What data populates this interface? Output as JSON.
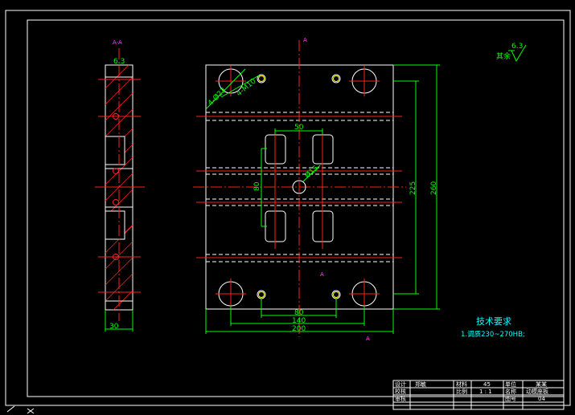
{
  "dimensions": {
    "d50": "50",
    "d80_vert": "80",
    "d80_bottom": "80",
    "d140": "140",
    "d200": "200",
    "d225": "225",
    "d260": "260",
    "d30": "30",
    "hole1": "4-Ø23",
    "hole2": "4-M10",
    "center_hole": "Ø15"
  },
  "roughness": {
    "value": "6.3",
    "prefix": "其余"
  },
  "technical": {
    "heading": "技术要求",
    "item1": "1.调质230~270HB;"
  },
  "title_block": {
    "design_label": "设计",
    "design_value": "郑敏",
    "check_label": "校核",
    "approve_label": "审核",
    "material_label": "材料",
    "material_value": "45",
    "scale_label": "比例",
    "scale_value": "1 : 1",
    "unit_label": "单位",
    "unit_value": "某某",
    "name_label": "名称",
    "name_value": "动模座板",
    "drawing_label": "图号",
    "drawing_value": "04"
  },
  "colors": {
    "outline": "#ffffff",
    "centerline": "#ff2020",
    "dimension": "#00ff00",
    "text": "#00ffff"
  }
}
